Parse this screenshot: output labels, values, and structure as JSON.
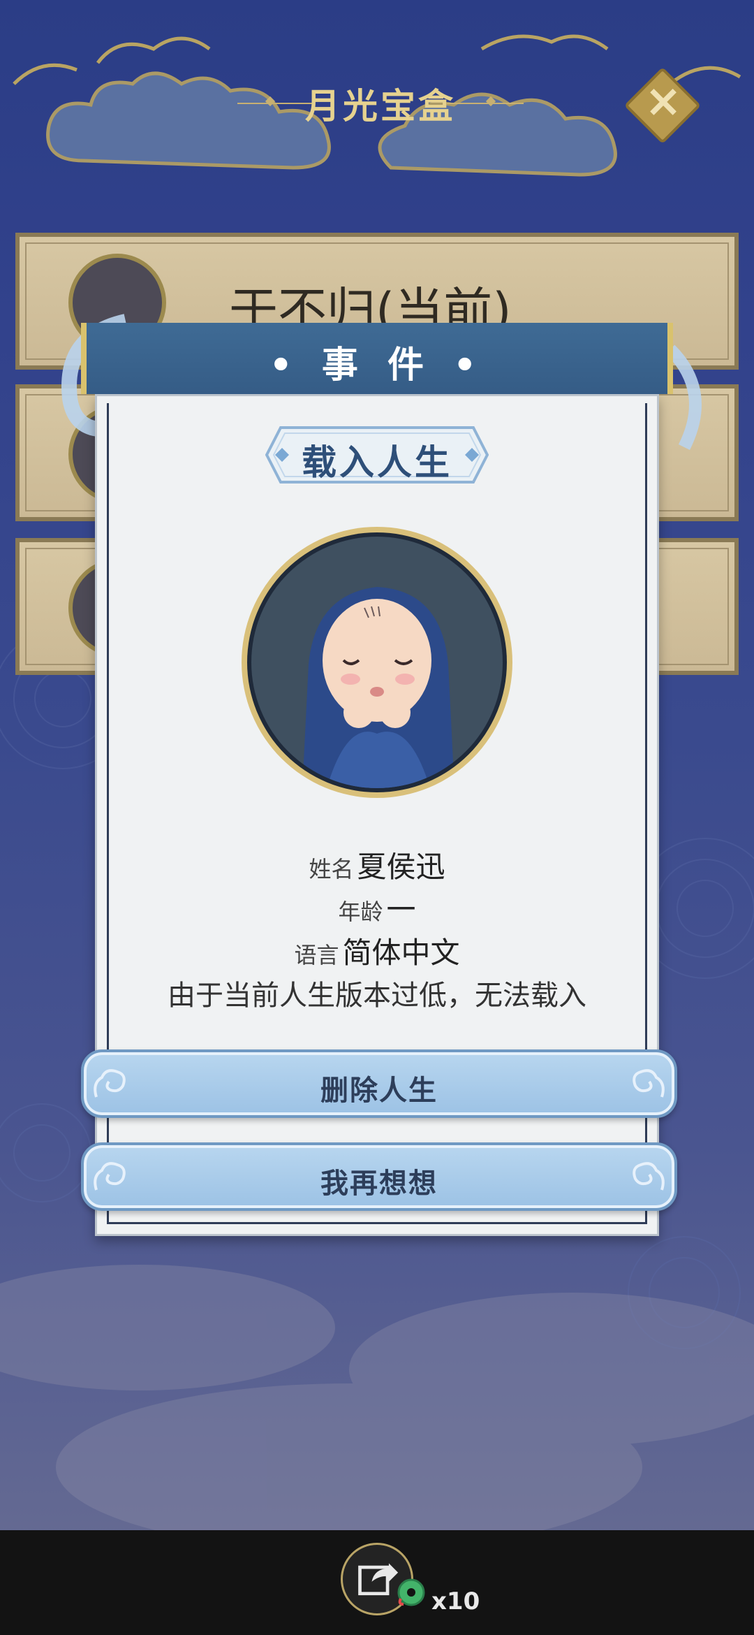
{
  "header": {
    "title": "月光宝盒",
    "close_icon": "close-icon"
  },
  "slots": [
    {
      "name": "于不归(当前)"
    },
    {
      "name": ""
    },
    {
      "name": ""
    }
  ],
  "dialog": {
    "title": "• 事 件 •",
    "badge": "载入人生",
    "info": {
      "name_label": "姓名",
      "name_value": "夏侯迅",
      "age_label": "年龄",
      "age_value": "一",
      "lang_label": "语言",
      "lang_value": "简体中文",
      "warning": "由于当前人生版本过低，无法载入"
    },
    "buttons": {
      "delete": "删除人生",
      "think": "我再想想"
    }
  },
  "bottom_bar": {
    "share_icon": "share-icon",
    "jade_icon": "jade-coin-icon",
    "count": "x10"
  },
  "colors": {
    "header_blue": "#3f6b95",
    "button_blue": "#9cc2e5",
    "gold": "#d9c26d"
  }
}
